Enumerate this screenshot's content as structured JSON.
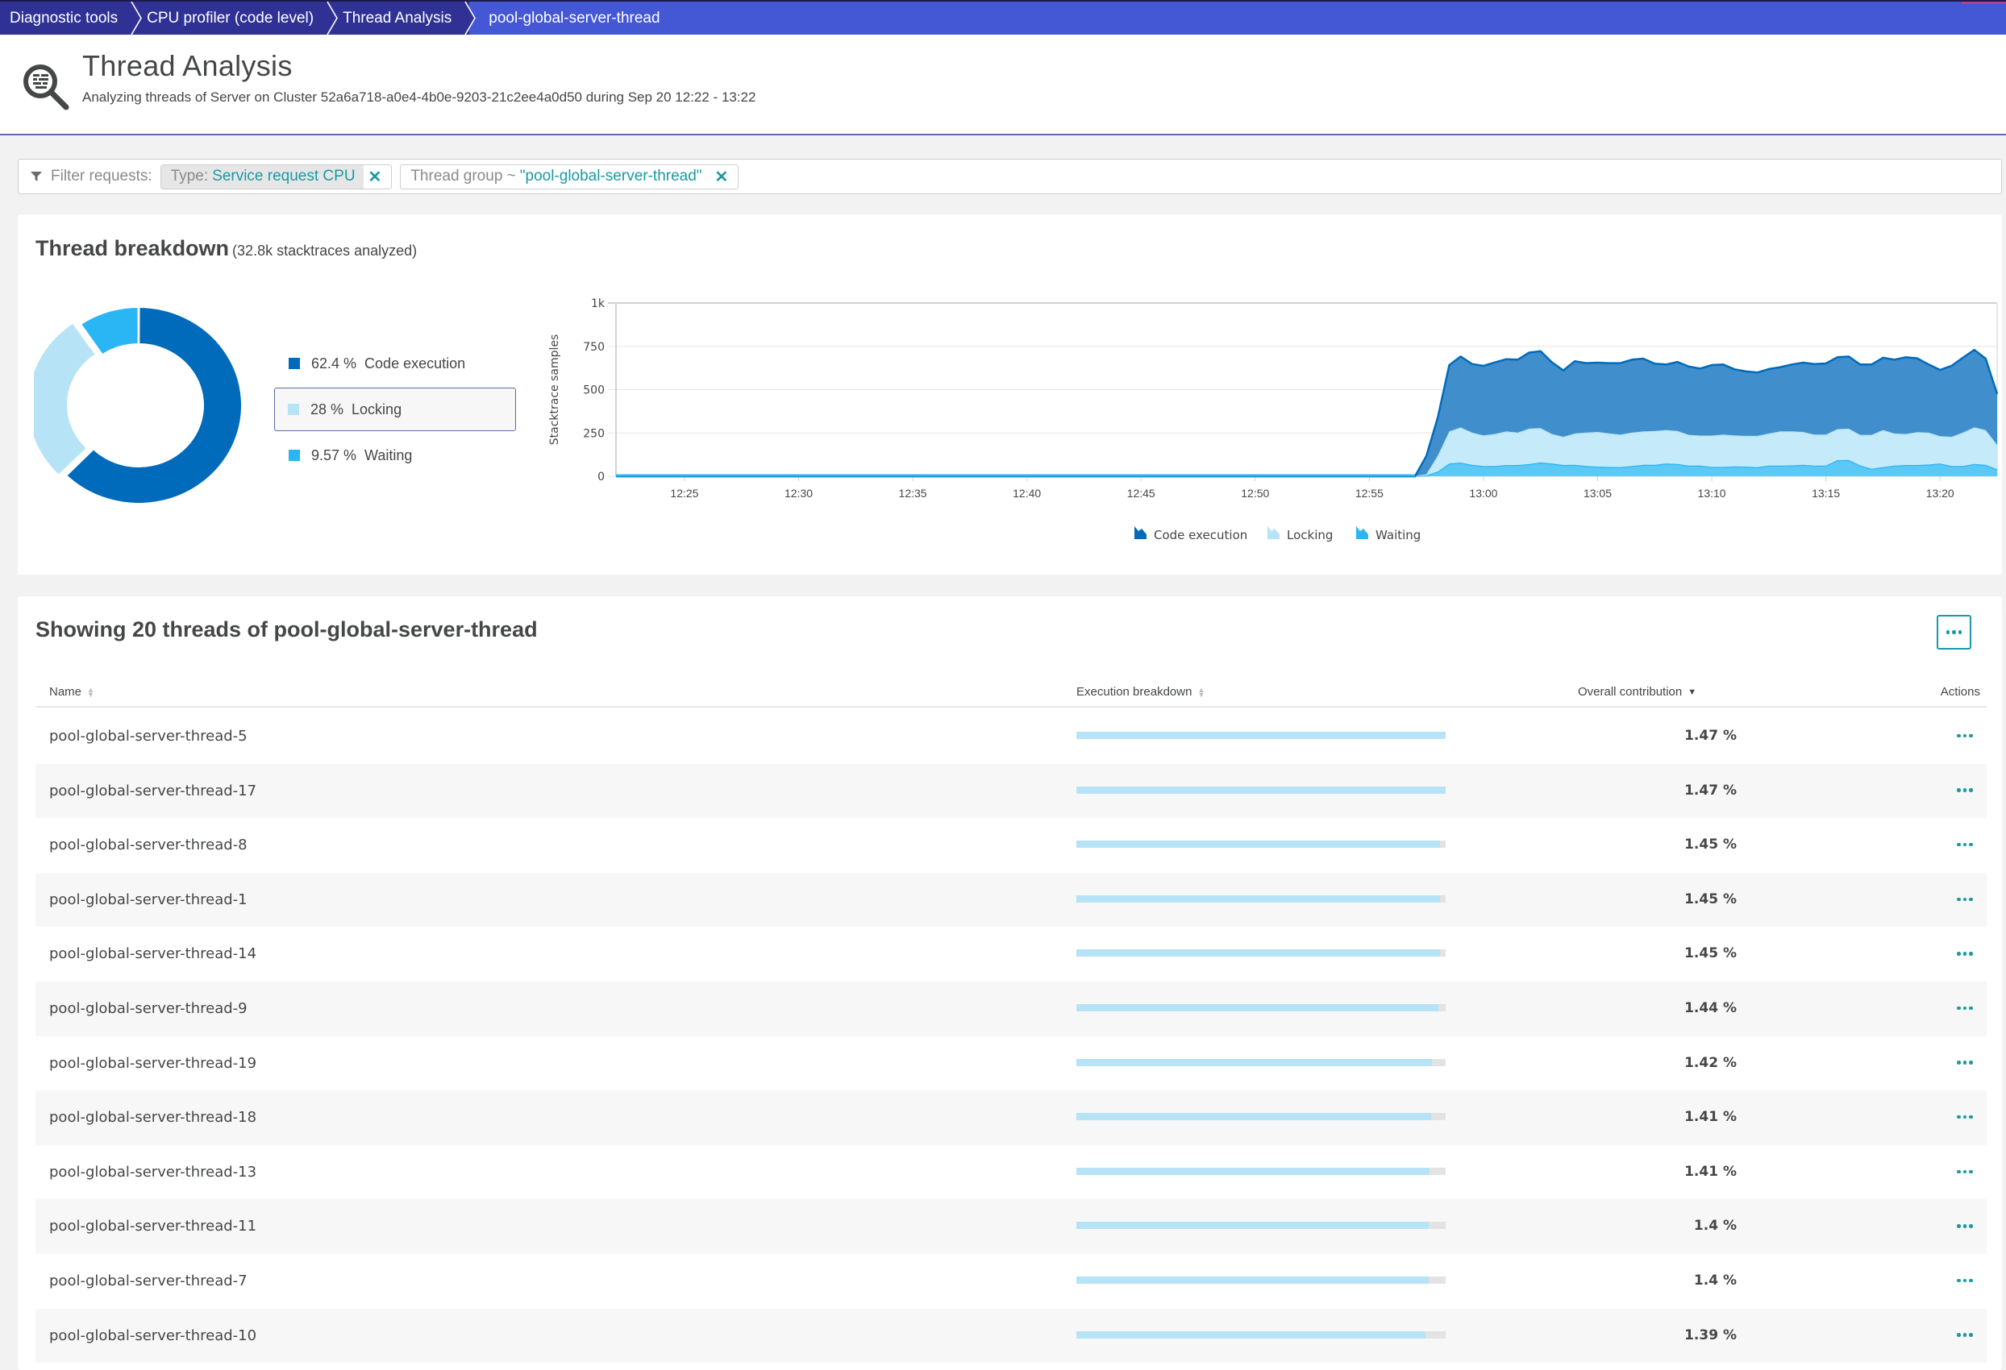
{
  "breadcrumb": [
    {
      "label": "Diagnostic tools"
    },
    {
      "label": "CPU profiler (code level)"
    },
    {
      "label": "Thread Analysis"
    },
    {
      "label": "pool-global-server-thread"
    }
  ],
  "header": {
    "icon": "thread-analysis-magnifier-icon",
    "title": "Thread Analysis",
    "subtitle": "Analyzing threads of Server on Cluster 52a6a718-a0e4-4b0e-9203-21c2ee4a0d50 during Sep 20 12:22 - 13:22"
  },
  "filter": {
    "label": "Filter requests:",
    "chips": [
      {
        "key": "Type:",
        "value": "Service request CPU"
      },
      {
        "key": "Thread group ~",
        "value": "\"pool-global-server-thread\""
      }
    ]
  },
  "colors": {
    "code_execution": "#006bba",
    "locking": "#b6e4f6",
    "waiting": "#2ab6f4",
    "accent": "#1a9aa3",
    "breadcrumb_dark": "#2f3294",
    "breadcrumb_current": "#4457d4"
  },
  "breakdown": {
    "title": "Thread breakdown",
    "note": "(32.8k stacktraces analyzed)",
    "legend": [
      {
        "pct": "62.4 %",
        "label": "Code execution",
        "selected": false
      },
      {
        "pct": "28 %",
        "label": "Locking",
        "selected": true
      },
      {
        "pct": "9.57 %",
        "label": "Waiting",
        "selected": false
      }
    ]
  },
  "chart_data": [
    {
      "type": "pie",
      "variant": "donut",
      "categories": [
        "Code execution",
        "Locking",
        "Waiting"
      ],
      "values": [
        62.4,
        28,
        9.57
      ],
      "unit": "%",
      "highlighted": "Locking"
    },
    {
      "type": "area",
      "stacked": true,
      "title": "",
      "xlabel": "",
      "ylabel": "Stacktrace samples",
      "ylim": [
        0,
        1000
      ],
      "yticks": [
        "0",
        "250",
        "500",
        "750",
        "1k"
      ],
      "xticks": [
        "12:25",
        "12:30",
        "12:35",
        "12:40",
        "12:45",
        "12:50",
        "12:55",
        "13:00",
        "13:05",
        "13:10",
        "13:15",
        "13:20"
      ],
      "xrange": [
        "12:22",
        "13:22:30"
      ],
      "grid": true,
      "legend_position": "bottom",
      "x": [
        "12:22:00",
        "12:56:30",
        "12:57:00",
        "12:57:30",
        "12:58:00",
        "12:58:30",
        "12:59:00",
        "12:59:30",
        "13:00:00",
        "13:00:30",
        "13:01:00",
        "13:01:30",
        "13:02:00",
        "13:02:30",
        "13:03:00",
        "13:03:30",
        "13:04:00",
        "13:04:30",
        "13:05:00",
        "13:05:30",
        "13:06:00",
        "13:06:30",
        "13:07:00",
        "13:07:30",
        "13:08:00",
        "13:08:30",
        "13:09:00",
        "13:09:30",
        "13:10:00",
        "13:10:30",
        "13:11:00",
        "13:11:30",
        "13:12:00",
        "13:12:30",
        "13:13:00",
        "13:13:30",
        "13:14:00",
        "13:14:30",
        "13:15:00",
        "13:15:30",
        "13:16:00",
        "13:16:30",
        "13:17:00",
        "13:17:30",
        "13:18:00",
        "13:18:30",
        "13:19:00",
        "13:19:30",
        "13:20:00",
        "13:20:30",
        "13:21:00",
        "13:21:30",
        "13:22:00",
        "13:22:30"
      ],
      "series": [
        {
          "name": "Waiting",
          "values": [
            0,
            0,
            0,
            5,
            28,
            74,
            79,
            66,
            59,
            59,
            65,
            65,
            70,
            80,
            74,
            65,
            66,
            59,
            56,
            54,
            53,
            59,
            66,
            66,
            74,
            71,
            62,
            62,
            54,
            54,
            57,
            56,
            53,
            62,
            62,
            63,
            66,
            62,
            62,
            93,
            94,
            63,
            43,
            53,
            62,
            65,
            65,
            68,
            74,
            59,
            59,
            71,
            66,
            40
          ]
        },
        {
          "name": "Locking",
          "values": [
            0,
            0,
            0,
            7,
            92,
            185,
            203,
            186,
            177,
            185,
            194,
            187,
            205,
            198,
            170,
            163,
            181,
            193,
            200,
            194,
            188,
            193,
            193,
            196,
            193,
            191,
            177,
            173,
            181,
            187,
            179,
            177,
            180,
            185,
            197,
            196,
            190,
            179,
            179,
            179,
            181,
            176,
            196,
            214,
            185,
            179,
            190,
            184,
            157,
            169,
            193,
            212,
            201,
            142
          ]
        },
        {
          "name": "Code execution",
          "values": [
            0,
            0,
            0,
            105,
            220,
            383,
            409,
            396,
            401,
            413,
            417,
            421,
            439,
            444,
            413,
            383,
            417,
            401,
            400,
            405,
            412,
            421,
            420,
            388,
            378,
            398,
            394,
            387,
            407,
            404,
            381,
            372,
            366,
            372,
            371,
            386,
            400,
            407,
            410,
            415,
            416,
            406,
            406,
            417,
            426,
            443,
            426,
            393,
            383,
            409,
            432,
            447,
            412,
            293
          ]
        }
      ]
    }
  ],
  "area_legend": [
    {
      "label": "Code execution",
      "icon": "area-series-icon"
    },
    {
      "label": "Locking",
      "icon": "area-series-icon"
    },
    {
      "label": "Waiting",
      "icon": "area-series-icon"
    }
  ],
  "threads": {
    "title": "Showing 20 threads of pool-global-server-thread",
    "columns": {
      "name": "Name",
      "breakdown": "Execution breakdown",
      "contribution": "Overall contribution",
      "actions": "Actions"
    },
    "sort": {
      "column": "Overall contribution",
      "direction": "descending"
    },
    "rows": [
      {
        "name": "pool-global-server-thread-5",
        "contribution": "1.47 %",
        "breakdown_fill": 1.0
      },
      {
        "name": "pool-global-server-thread-17",
        "contribution": "1.47 %",
        "breakdown_fill": 1.0
      },
      {
        "name": "pool-global-server-thread-8",
        "contribution": "1.45 %",
        "breakdown_fill": 0.985
      },
      {
        "name": "pool-global-server-thread-1",
        "contribution": "1.45 %",
        "breakdown_fill": 0.985
      },
      {
        "name": "pool-global-server-thread-14",
        "contribution": "1.45 %",
        "breakdown_fill": 0.985
      },
      {
        "name": "pool-global-server-thread-9",
        "contribution": "1.44 %",
        "breakdown_fill": 0.981
      },
      {
        "name": "pool-global-server-thread-19",
        "contribution": "1.42 %",
        "breakdown_fill": 0.963
      },
      {
        "name": "pool-global-server-thread-18",
        "contribution": "1.41 %",
        "breakdown_fill": 0.961
      },
      {
        "name": "pool-global-server-thread-13",
        "contribution": "1.41 %",
        "breakdown_fill": 0.957
      },
      {
        "name": "pool-global-server-thread-11",
        "contribution": "1.4 %",
        "breakdown_fill": 0.955
      },
      {
        "name": "pool-global-server-thread-7",
        "contribution": "1.4 %",
        "breakdown_fill": 0.955
      },
      {
        "name": "pool-global-server-thread-10",
        "contribution": "1.39 %",
        "breakdown_fill": 0.946
      }
    ]
  }
}
